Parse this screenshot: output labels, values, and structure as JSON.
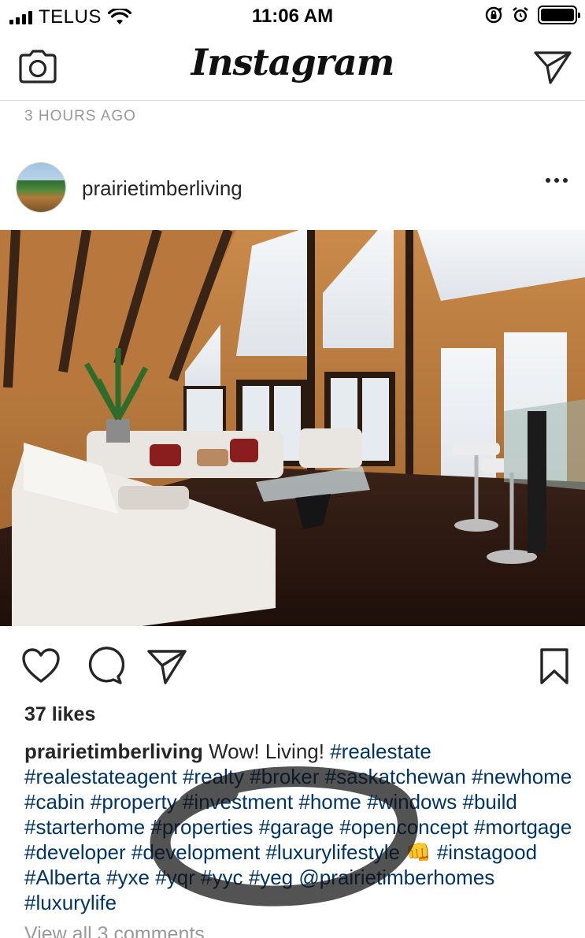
{
  "status_bar": {
    "carrier": "TELUS",
    "time": "11:06 AM",
    "icons": [
      "signal-icon",
      "wifi-icon",
      "rotation-lock-icon",
      "alarm-icon",
      "battery-icon"
    ]
  },
  "header": {
    "brand": "Instagram",
    "left_icon": "camera-icon",
    "right_icon": "direct-message-icon"
  },
  "post": {
    "timestamp": "3 HOURS AGO",
    "username": "prairietimberliving",
    "likes": "37 likes",
    "caption_user": "prairietimberliving",
    "caption_text": " Wow! Living! ",
    "hashtags": [
      "#realestate",
      "#realestateagent",
      "#realty",
      "#broker",
      "#saskatchewan",
      "#newhome",
      "#cabin",
      "#property",
      "#investment",
      "#home",
      "#windows",
      "#build",
      "#starterhome",
      "#properties",
      "#garage",
      "#openconcept",
      "#mortgage",
      "#developer",
      "#development",
      "#luxurylifestyle",
      "👊",
      "#instagood",
      "#Alberta",
      "#yxe",
      "#yqr",
      "#yyc",
      "#yeg",
      "@prairietimberhomes",
      "#luxurylife"
    ],
    "view_comments": "View all 3 comments",
    "action_icons": [
      "heart-icon",
      "comment-icon",
      "share-icon",
      "bookmark-icon"
    ]
  },
  "colors": {
    "hashtag": "#003569",
    "secondary_text": "#999999",
    "divider": "#dbdbdb"
  }
}
